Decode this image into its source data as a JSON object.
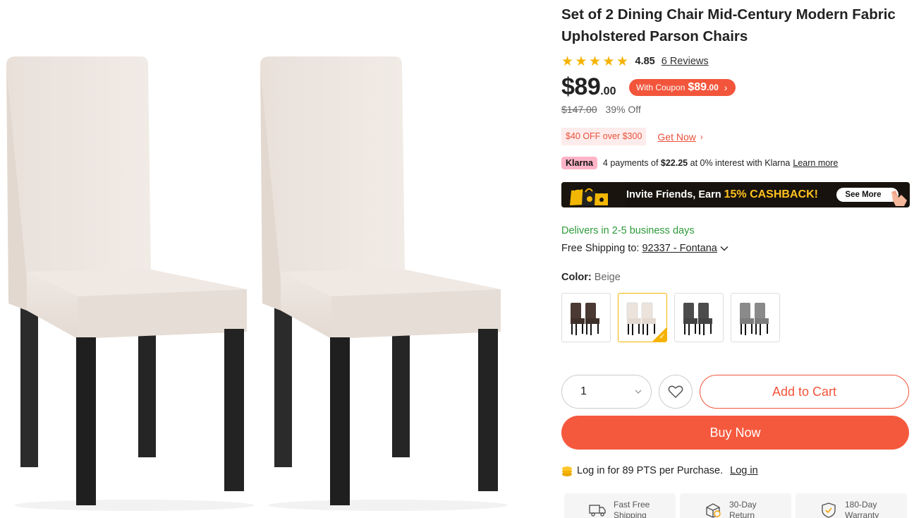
{
  "product": {
    "title": "Set of 2 Dining Chair Mid-Century Modern Fabric Upholstered Parson Chairs",
    "rating_value": "4.85",
    "rating_stars": 5,
    "reviews_label": "6 Reviews",
    "price_main": "$89",
    "price_cents": ".00",
    "coupon": {
      "label": "With Coupon",
      "amount": "$89",
      "amount_cents": ".00",
      "chevron": "chevron-right-icon"
    },
    "was_price": "$147.00",
    "discount": "39% Off",
    "promo_tag": "$40 OFF over $300",
    "get_now": "Get Now",
    "klarna": {
      "badge": "Klarna",
      "text_before": "4 payments of",
      "amount": "$22.25",
      "text_after": "at 0% interest with Klarna",
      "learn_more": "Learn more"
    },
    "banner": {
      "text": "Invite Friends, Earn ",
      "highlight": "15% CASHBACK!",
      "see_more": "See More"
    },
    "delivers": "Delivers in 2-5 business days",
    "shipping_label": "Free Shipping to:",
    "shipping_zip": "92337 - Fontana",
    "color_label": "Color:",
    "color_value": "Beige",
    "swatches": [
      "Brown",
      "Beige",
      "Dark Gray",
      "Gray"
    ],
    "quantity": "1",
    "add_to_cart": "Add to Cart",
    "buy_now": "Buy Now",
    "points_text": "Log in for 89 PTS per Purchase.",
    "login_link": "Log in",
    "features": [
      {
        "line1": "Fast Free",
        "line2": "Shipping"
      },
      {
        "line1": "30-Day",
        "line2": "Return"
      },
      {
        "line1": "180-Day",
        "line2": "Warranty"
      }
    ]
  },
  "colors": {
    "accent": "#f2553b",
    "star": "#f5b301",
    "green": "#2e9a3a",
    "klarna_pink": "#ffb3c7",
    "chair_fabric": "#ece3dd",
    "chair_leg": "#2a2a2a"
  }
}
